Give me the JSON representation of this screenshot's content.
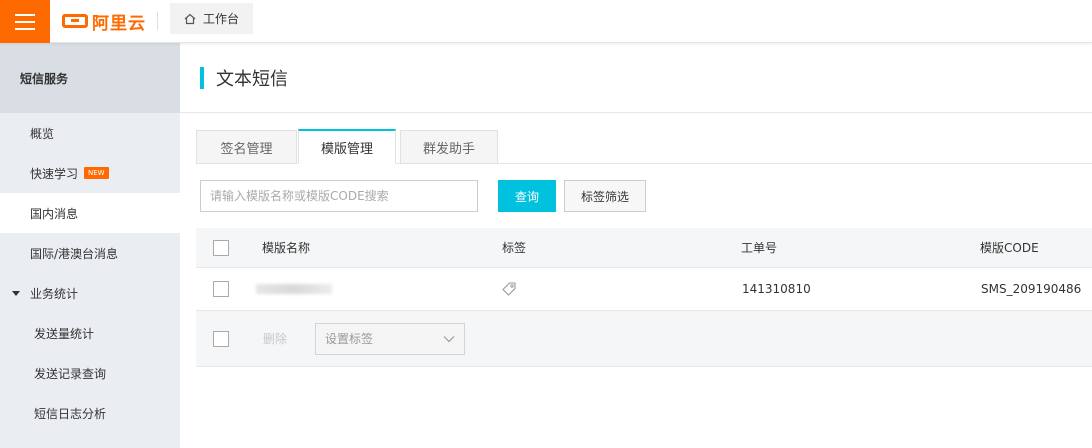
{
  "topbar": {
    "logo_text": "阿里云",
    "workbench_label": "工作台"
  },
  "sidebar": {
    "title": "短信服务",
    "items": [
      {
        "label": "概览"
      },
      {
        "label": "快速学习",
        "badge": "NEW"
      },
      {
        "label": "国内消息"
      },
      {
        "label": "国际/港澳台消息"
      },
      {
        "label": "业务统计"
      },
      {
        "label": "发送量统计"
      },
      {
        "label": "发送记录查询"
      },
      {
        "label": "短信日志分析"
      }
    ]
  },
  "main": {
    "title": "文本短信",
    "tabs": [
      {
        "label": "签名管理"
      },
      {
        "label": "模版管理"
      },
      {
        "label": "群发助手"
      }
    ],
    "search": {
      "placeholder": "请输入模版名称或模版CODE搜索"
    },
    "query_button": "查询",
    "tag_filter_button": "标签筛选",
    "table": {
      "headers": [
        "模版名称",
        "标签",
        "工单号",
        "模版CODE"
      ],
      "rows": [
        {
          "order_no": "141310810",
          "template_code": "SMS_209190486"
        }
      ]
    },
    "footer": {
      "delete_label": "删除",
      "set_tag_placeholder": "设置标签"
    }
  },
  "colors": {
    "brand_orange": "#ff6a00",
    "accent_cyan": "#00c1de"
  }
}
